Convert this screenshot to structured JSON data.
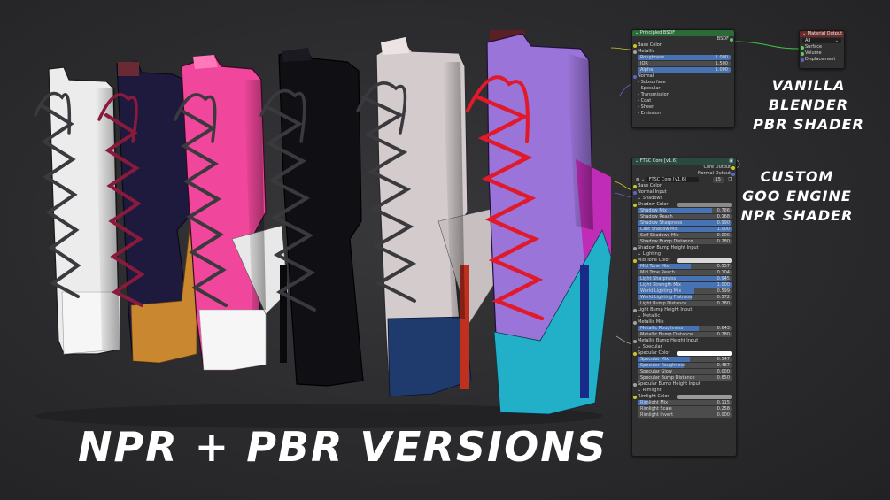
{
  "captions": {
    "main": "NPR + PBR VERSIONS",
    "vanilla": [
      "VANILLA BLENDER",
      "PBR SHADER"
    ],
    "custom": [
      "CUSTOM",
      "GOO ENGINE",
      "NPR SHADER"
    ]
  },
  "colors": {
    "boot1": "#ececec",
    "boot2_upper": "#1e1a3e",
    "boot2_toe": "#c98830",
    "boot3": "#f0469b",
    "boot4": "#101014",
    "boot5_upper": "#d4cccc",
    "boot5_toe": "#1f3a6c",
    "boot6_upper": "#9a74d8",
    "boot6_toe": "#21b0c8",
    "boot6_heel": "#c02cb8",
    "laces_dark": "#3a3a3e",
    "laces_red": "#e01a2a",
    "laces_wine": "#8a1a3c",
    "node_green_header": "#2b6b38",
    "node_red_header": "#6b2b2b",
    "slider_blue": "#4772b3"
  },
  "principled": {
    "title": "Principled BSDF",
    "output": "BSDF",
    "base_color": "Base Color",
    "metallic": "Metallic",
    "sliders": [
      {
        "label": "Roughness",
        "value": "1.000",
        "fill": 1.0
      },
      {
        "label": "IOR",
        "value": "1.500",
        "fill": 0.0
      },
      {
        "label": "Alpha",
        "value": "1.000",
        "fill": 1.0
      }
    ],
    "normal": "Normal",
    "panels": [
      "Subsurface",
      "Specular",
      "Transmission",
      "Coat",
      "Sheen",
      "Emission"
    ]
  },
  "material_output": {
    "title": "Material Output",
    "target": "All",
    "inputs": [
      "Surface",
      "Volume",
      "Displacement"
    ]
  },
  "ftsc": {
    "title": "FTSC Core [v1.6]",
    "outputs": [
      "Core Output",
      "Normal Output"
    ],
    "group_name": "FTSC Core [v1.6]",
    "users": "15",
    "rows": [
      {
        "kind": "socket",
        "label": "Base Color",
        "sock": "y"
      },
      {
        "kind": "socket",
        "label": "Normal Input",
        "sock": "p"
      },
      {
        "kind": "section",
        "label": "Shadows"
      },
      {
        "kind": "color",
        "label": "Shadow Color",
        "sock": "y",
        "swatch": "#8a8a8a"
      },
      {
        "kind": "slider",
        "label": "Shadow Mix",
        "value": "0.786",
        "fill": 0.786
      },
      {
        "kind": "slider",
        "label": "Shadow Reach",
        "value": "0.168",
        "fill": 0.0
      },
      {
        "kind": "slider",
        "label": "Shadow Sharpness",
        "value": "0.990",
        "fill": 0.99
      },
      {
        "kind": "slider",
        "label": "Cast Shadow Mix",
        "value": "1.000",
        "fill": 1.0
      },
      {
        "kind": "slider",
        "label": "Self Shadows Mix",
        "value": "0.000",
        "fill": 0.0
      },
      {
        "kind": "slider",
        "label": "Shadow Bump Distance",
        "value": "0.280",
        "fill": 0.0
      },
      {
        "kind": "socket",
        "label": "Shadow Bump Height Input",
        "sock": "g"
      },
      {
        "kind": "section",
        "label": "Lighting"
      },
      {
        "kind": "color",
        "label": "Mid Tone Color",
        "sock": "y",
        "swatch": "#d8d8d8"
      },
      {
        "kind": "slider",
        "label": "Mid Tone Mix",
        "value": "0.557",
        "fill": 0.557
      },
      {
        "kind": "slider",
        "label": "Mid Tone Reach",
        "value": "0.104",
        "fill": 0.0
      },
      {
        "kind": "slider",
        "label": "Light Sharpness",
        "value": "0.945",
        "fill": 0.945
      },
      {
        "kind": "slider",
        "label": "Light Strength Mix",
        "value": "1.000",
        "fill": 1.0
      },
      {
        "kind": "slider",
        "label": "World Lighting Mix",
        "value": "0.599",
        "fill": 0.599
      },
      {
        "kind": "slider",
        "label": "World Lighting Flatness",
        "value": "0.572",
        "fill": 0.572
      },
      {
        "kind": "slider",
        "label": "Light Bump Distance",
        "value": "0.280",
        "fill": 0.0
      },
      {
        "kind": "socket",
        "label": "Light Bump Height Input",
        "sock": "g"
      },
      {
        "kind": "section",
        "label": "Metallic"
      },
      {
        "kind": "socket",
        "label": "Metallic Mix",
        "sock": "g"
      },
      {
        "kind": "slider",
        "label": "Metallic Roughness",
        "value": "0.643",
        "fill": 0.643
      },
      {
        "kind": "slider",
        "label": "Metallic Bump Distance",
        "value": "0.280",
        "fill": 0.0
      },
      {
        "kind": "socket",
        "label": "Metallic Bump Height Input",
        "sock": "g"
      },
      {
        "kind": "section",
        "label": "Specular"
      },
      {
        "kind": "color",
        "label": "Specular Color",
        "sock": "y",
        "swatch": "#ffffff"
      },
      {
        "kind": "slider",
        "label": "Specular Mix",
        "value": "0.547",
        "fill": 0.547
      },
      {
        "kind": "slider",
        "label": "Specular Roughness",
        "value": "0.487",
        "fill": 0.487
      },
      {
        "kind": "slider",
        "label": "Specular Glow",
        "value": "0.000",
        "fill": 0.0
      },
      {
        "kind": "slider",
        "label": "Specular Bump Distance",
        "value": "0.650",
        "fill": 0.0
      },
      {
        "kind": "socket",
        "label": "Specular Bump Height Input",
        "sock": "g"
      },
      {
        "kind": "section",
        "label": "Rimlight"
      },
      {
        "kind": "color",
        "label": "Rimlight Color",
        "sock": "y",
        "swatch": "#9a9a9a"
      },
      {
        "kind": "slider",
        "label": "Rimlight Mix",
        "value": "0.115",
        "fill": 0.115
      },
      {
        "kind": "slider",
        "label": "Rimlight Scale",
        "value": "0.258",
        "fill": 0.0
      },
      {
        "kind": "slider",
        "label": "Rimlight Invert",
        "value": "0.000",
        "fill": 0.0
      }
    ]
  }
}
